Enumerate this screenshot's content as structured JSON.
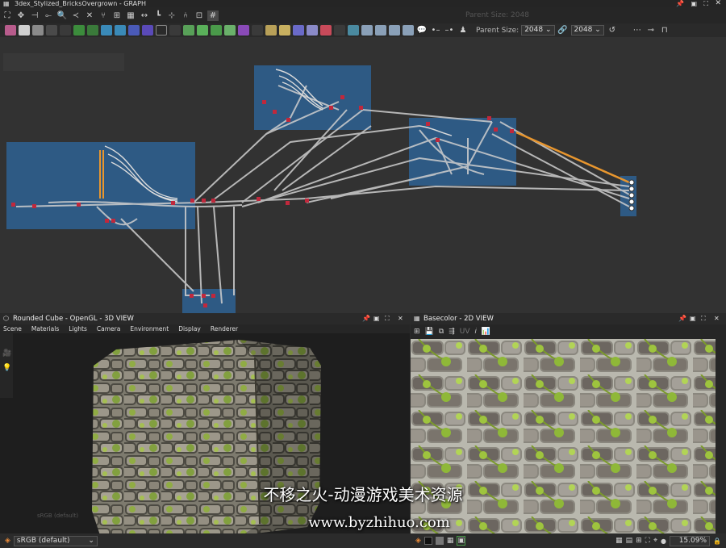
{
  "graph": {
    "title": "3dex_Stylized_BricksOvergrown - GRAPH",
    "parent_size_label": "Parent Size:",
    "parent_size_value": "2048",
    "size_value": "2048",
    "ghost_text": "Parent Size: 2048"
  },
  "view3d": {
    "title": "Rounded Cube - OpenGL - 3D VIEW",
    "menu": [
      "Scene",
      "Materials",
      "Lights",
      "Camera",
      "Environment",
      "Display",
      "Renderer"
    ],
    "colorspace": "sRGB (default)"
  },
  "view2d": {
    "title": "Basecolor - 2D VIEW",
    "uv_label": "UV",
    "zoom": "15.09%"
  },
  "watermark": {
    "text": "不移之火-动漫游戏美术资源",
    "url": "www.byzhihuo.com"
  },
  "colors": {
    "frame": "#2e68a0",
    "wire": "#cfcfcf",
    "wire_active": "#e8962e",
    "node_pin": "#c0283c"
  }
}
